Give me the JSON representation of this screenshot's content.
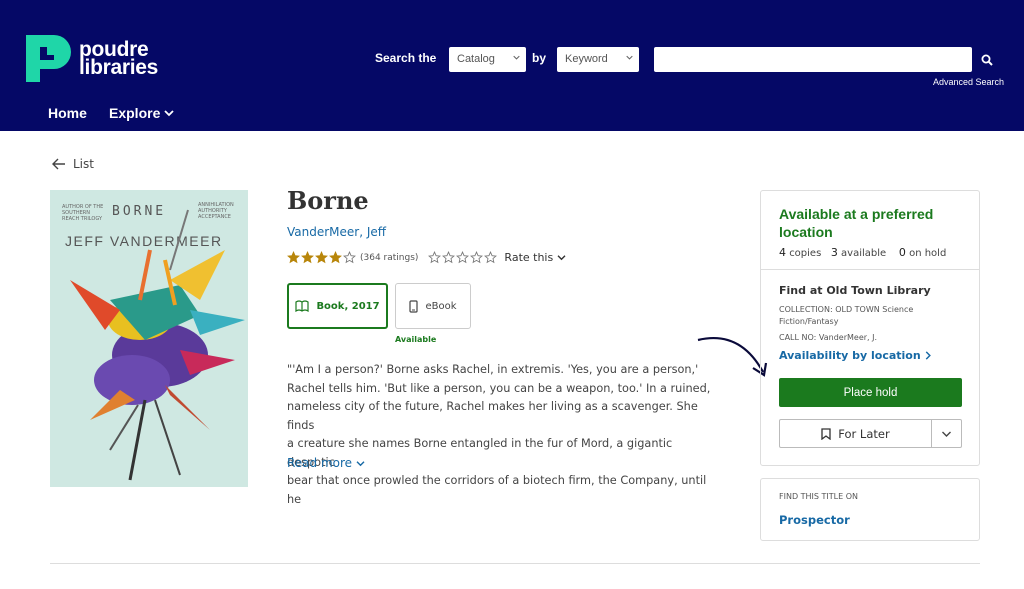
{
  "header": {
    "logo_line1": "poudre",
    "logo_line2": "libraries",
    "search_the_label": "Search the",
    "catalog_select": "Catalog",
    "by_label": "by",
    "keyword_select": "Keyword",
    "search_input_value": "",
    "advanced_search": "Advanced Search",
    "nav": {
      "home": "Home",
      "explore": "Explore"
    },
    "colors": {
      "background": "#050866",
      "logo_accent": "#1fd6a8"
    }
  },
  "back_link": "List",
  "book": {
    "cover": {
      "author": "JEFF VANDERMEER",
      "title": "BORNE",
      "left_blurb": "AUTHOR OF THE SOUTHERN REACH TRILOGY",
      "right_blurb": "ANNIHILATION AUTHORITY ACCEPTANCE"
    },
    "title": "Borne",
    "author": "VanderMeer, Jeff",
    "rating": {
      "stars": 4,
      "max": 5,
      "ratings_text": "(364 ratings)",
      "rate_this": "Rate this"
    },
    "formats": [
      {
        "label": "Book, 2017",
        "selected": true,
        "icon": "book-open-icon"
      },
      {
        "label": "eBook",
        "selected": false,
        "icon": "tablet-icon"
      }
    ],
    "ebook_status": "Available",
    "description_lines": [
      "\"'Am I a person?' Borne asks Rachel, in extremis. 'Yes, you are a person,'",
      "Rachel tells him. 'But like a person, you can be a weapon, too.' In a ruined,",
      "nameless city of the future, Rachel makes her living as a scavenger. She finds",
      "a creature she names Borne entangled in the fur of Mord, a gigantic despotic",
      "bear that once prowled the corridors of a biotech firm, the Company, until he"
    ],
    "read_more": "Read more"
  },
  "availability": {
    "title": "Available at a preferred location",
    "copies_num": "4",
    "copies_label": "copies",
    "available_num": "3",
    "available_label": "available",
    "on_hold_num": "0",
    "on_hold_label": "on hold",
    "find_at": "Find at Old Town Library",
    "collection_line1": "COLLECTION:  OLD TOWN Science",
    "collection_line2": "Fiction/Fantasy",
    "call_no": "CALL NO:  VanderMeer, J.",
    "availability_by_location": "Availability by location",
    "place_hold": "Place hold",
    "for_later": "For Later"
  },
  "find_elsewhere": {
    "label": "FIND THIS TITLE ON",
    "link": "Prospector"
  }
}
